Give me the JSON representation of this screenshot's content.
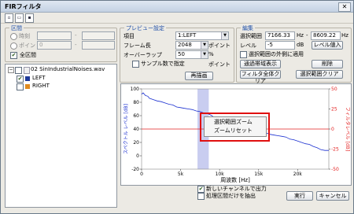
{
  "window": {
    "title": "FIRフィルタ",
    "close_glyph": "✕"
  },
  "toolbar": {
    "icons": [
      "new-icon",
      "open-icon",
      "save-icon"
    ]
  },
  "range": {
    "title": "区間",
    "time_label": "時刻",
    "point_label": "ポイント",
    "point_from": "0",
    "dash": "-",
    "all_label": "全区間",
    "all_checked": true
  },
  "tree": {
    "file": "02 SinIndustrialNoises.wav",
    "channels": [
      {
        "label": "LEFT",
        "checked": true,
        "color": "#1e3a9a"
      },
      {
        "label": "RIGHT",
        "checked": false,
        "color": "#e08a1e"
      }
    ]
  },
  "preview": {
    "title": "プレビュー設定",
    "item_label": "項目",
    "item_value": "1:LEFT",
    "frame_label": "フレーム長",
    "frame_value": "2048",
    "frame_unit": "ポイント",
    "overlap_label": "オーバーラップ",
    "overlap_value": "50",
    "overlap_unit": "%",
    "sample_label": "サンプル数で指定",
    "sample_unit": "ポイント",
    "redraw_label": "再描画"
  },
  "edit": {
    "title": "編集",
    "sel_label": "選択範囲",
    "sel_from": "7166.33",
    "sel_unit1": "Hz",
    "sel_dash": "-",
    "sel_to": "8609.22",
    "sel_unit2": "Hz",
    "level_label": "レベル",
    "level_value": "-5",
    "level_unit": "dB",
    "outside_label": "選択範囲の外側に適用",
    "outside_checked": false,
    "level_input_btn": "レベル値入",
    "passband_btn": "通過帯域表示",
    "delete_btn": "削除",
    "clear_all_btn": "フィルタ全体クリア",
    "clear_sel_btn": "選択範囲クリア"
  },
  "chart_data": {
    "type": "line",
    "xlabel": "周波数 [Hz]",
    "ylabel_left": "スペクトル レベル [dB]",
    "ylabel_right": "フィルタレベル [dB]",
    "x_ticks": [
      "0",
      "5k",
      "10k",
      "15k",
      "20k"
    ],
    "y_left_ticks": [
      "100",
      "80",
      "60",
      "40",
      "20",
      "0",
      "-20"
    ],
    "y_right_ticks": [
      "50",
      "25",
      "0",
      "-25",
      "-50"
    ],
    "xlim": [
      0,
      24000
    ],
    "ylim_left": [
      -20,
      100
    ],
    "ylim_right": [
      -50,
      50
    ],
    "selection_hz": [
      7166.33,
      8609.22
    ],
    "filter_level_db": 0,
    "colors": {
      "spectrum": "#1a2fd0",
      "filter": "#e32020",
      "selection": "#c9cdf0"
    },
    "spectrum": {
      "x": [
        0,
        200,
        500,
        800,
        1000,
        1500,
        2000,
        2500,
        3000,
        3500,
        4000,
        4500,
        5000,
        5500,
        6000,
        6500,
        7000,
        7500,
        8000,
        8500,
        9000,
        9500,
        10000,
        10500,
        11000,
        11500,
        12000,
        12500,
        13000,
        13500,
        14000,
        14500,
        15000,
        15500,
        16000,
        16500,
        17000,
        17500,
        18000,
        18500,
        19000,
        19500,
        20000,
        20500,
        21000,
        21500,
        22000,
        22500,
        23000,
        23500,
        24000
      ],
      "y": [
        92,
        94,
        90,
        89,
        86,
        84,
        82,
        81,
        79,
        77,
        76,
        73,
        72,
        71,
        70,
        69,
        67,
        66,
        64,
        63,
        60,
        55,
        54,
        52,
        50,
        46,
        45,
        44,
        42,
        41,
        40,
        39,
        37,
        36,
        34,
        32,
        31,
        30,
        29,
        28,
        25,
        24,
        22,
        20,
        18,
        17,
        14,
        12,
        9,
        8,
        8
      ]
    }
  },
  "context_menu": {
    "items": [
      "選択範囲ズーム",
      "ズームリセット"
    ]
  },
  "footer": {
    "stereo_label": "新しいチャンネルで出力",
    "stereo_checked": true,
    "selection_only_label": "処理区間だけを抽出",
    "selection_only_checked": false,
    "ok_label": "実行",
    "cancel_label": "キャンセル"
  }
}
